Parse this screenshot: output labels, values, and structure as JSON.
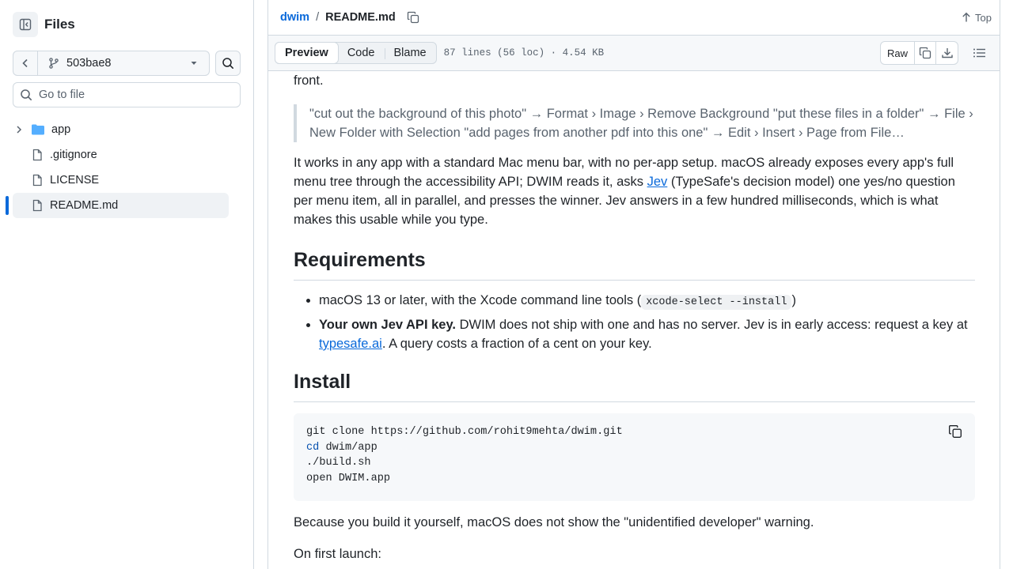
{
  "sidebar": {
    "title": "Files",
    "branch": "503bae8",
    "goto_placeholder": "Go to file",
    "items": [
      {
        "label": "app",
        "type": "folder"
      },
      {
        "label": ".gitignore",
        "type": "file"
      },
      {
        "label": "LICENSE",
        "type": "file"
      },
      {
        "label": "README.md",
        "type": "file",
        "active": true
      }
    ]
  },
  "header": {
    "repo": "dwim",
    "separator": "/",
    "file": "README.md",
    "top_label": "Top"
  },
  "toolbar": {
    "tabs": [
      "Preview",
      "Code",
      "Blame"
    ],
    "active_tab": "Preview",
    "meta": "87 lines (56 loc) · 4.54 KB",
    "raw_label": "Raw"
  },
  "readme": {
    "front": "front.",
    "quote": "\"cut out the background of this photo\" → Format › Image › Remove Background \"put these files in a folder\" → File › New Folder with Selection \"add pages from another pdf into this one\" → Edit › Insert › Page from File…",
    "para1_a": "It works in any app with a standard Mac menu bar, with no per-app setup. macOS already exposes every app's full menu tree through the accessibility API; DWIM reads it, asks ",
    "para1_link": "Jev",
    "para1_b": " (TypeSafe's decision model) one yes/no question per menu item, all in parallel, and presses the winner. Jev answers in a few hundred milliseconds, which is what makes this usable while you type.",
    "h_requirements": "Requirements",
    "req1_a": "macOS 13 or later, with the Xcode command line tools (",
    "req1_code": "xcode-select --install",
    "req1_b": ")",
    "req2_bold": "Your own Jev API key.",
    "req2_a": " DWIM does not ship with one and has no server. Jev is in early access: request a key at ",
    "req2_link": "typesafe.ai",
    "req2_b": ". A query costs a fraction of a cent on your key.",
    "h_install": "Install",
    "code_line1": "git clone https://github.com/rohit9mehta/dwim.git",
    "code_line2_kw": "cd",
    "code_line2_rest": " dwim/app",
    "code_line3": "./build.sh",
    "code_line4": "open DWIM.app",
    "para2": "Because you build it yourself, macOS does not show the \"unidentified developer\" warning.",
    "para3": "On first launch:"
  },
  "icons": {
    "sidebar_toggle": "sidebar-collapse-icon",
    "back": "chevron-left-icon",
    "branch": "git-branch-icon",
    "search": "search-icon",
    "folder": "folder-icon",
    "file": "file-icon",
    "copy": "copy-icon",
    "download": "download-icon",
    "outline": "list-unordered-icon",
    "arrow_up": "arrow-up-icon"
  },
  "colors": {
    "link": "#0969da",
    "folder": "#54aeff",
    "active_bar": "#0969da"
  }
}
